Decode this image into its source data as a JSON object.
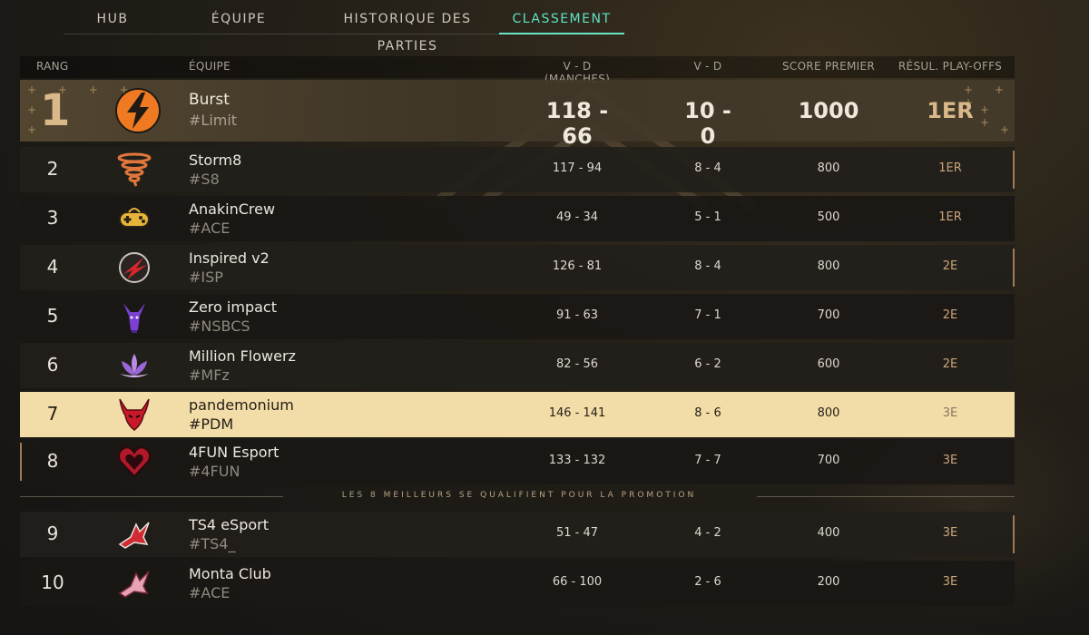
{
  "tabs": [
    {
      "label": "HUB"
    },
    {
      "label": "ÉQUIPE"
    },
    {
      "label": "HISTORIQUE DES PARTIES"
    },
    {
      "label": "CLASSEMENT",
      "active": true
    }
  ],
  "table": {
    "headers": {
      "rank": "RANG",
      "team": "ÉQUIPE",
      "rounds": "V - D (MANCHES)",
      "wl": "V - D",
      "score": "SCORE PREMIER",
      "playoffs": "RÉSUL. PLAY-OFFS"
    },
    "rows": [
      {
        "rank": "1",
        "name": "Burst",
        "tag": "#Limit",
        "rounds": "118 - 66",
        "wl": "10 - 0",
        "score": "1000",
        "playoffs": "1ER",
        "logo": "burst-lightning-icon"
      },
      {
        "rank": "2",
        "name": "Storm8",
        "tag": "#S8",
        "rounds": "117 - 94",
        "wl": "8 - 4",
        "score": "800",
        "playoffs": "1ER",
        "logo": "tornado-icon"
      },
      {
        "rank": "3",
        "name": "AnakinCrew",
        "tag": "#ACE",
        "rounds": "49 - 34",
        "wl": "5 - 1",
        "score": "500",
        "playoffs": "1ER",
        "logo": "gamepad-icon"
      },
      {
        "rank": "4",
        "name": "Inspired v2",
        "tag": "#ISP",
        "rounds": "126 - 81",
        "wl": "8 - 4",
        "score": "800",
        "playoffs": "2E",
        "logo": "red-streak-icon"
      },
      {
        "rank": "5",
        "name": "Zero impact",
        "tag": "#NSBCS",
        "rounds": "91 - 63",
        "wl": "7 - 1",
        "score": "700",
        "playoffs": "2E",
        "logo": "goat-icon"
      },
      {
        "rank": "6",
        "name": "Million Flowerz",
        "tag": "#MFz",
        "rounds": "82 - 56",
        "wl": "6 - 2",
        "score": "600",
        "playoffs": "2E",
        "logo": "lotus-icon"
      },
      {
        "rank": "7",
        "name": "pandemonium",
        "tag": "#PDM",
        "rounds": "146 - 141",
        "wl": "8 - 6",
        "score": "800",
        "playoffs": "3E",
        "logo": "demon-icon",
        "highlight": true
      },
      {
        "rank": "8",
        "name": "4FUN Esport",
        "tag": "#4FUN",
        "rounds": "133 - 132",
        "wl": "7 - 7",
        "score": "700",
        "playoffs": "3E",
        "logo": "heart-icon"
      },
      {
        "rank": "9",
        "name": "TS4 eSport",
        "tag": "#TS4_",
        "rounds": "51 - 47",
        "wl": "4 - 2",
        "score": "400",
        "playoffs": "3E",
        "logo": "red-fox-icon"
      },
      {
        "rank": "10",
        "name": "Monta Club",
        "tag": "#ACE",
        "rounds": "66 - 100",
        "wl": "2 - 6",
        "score": "200",
        "playoffs": "3E",
        "logo": "pink-fox-icon"
      }
    ],
    "separator": "LES 8 MEILLEURS SE QUALIFIENT POUR LA PROMOTION"
  },
  "colors": {
    "accent": "#5fe3c4",
    "highlight_row": "#f2dca7",
    "gold": "#d9b98a"
  }
}
